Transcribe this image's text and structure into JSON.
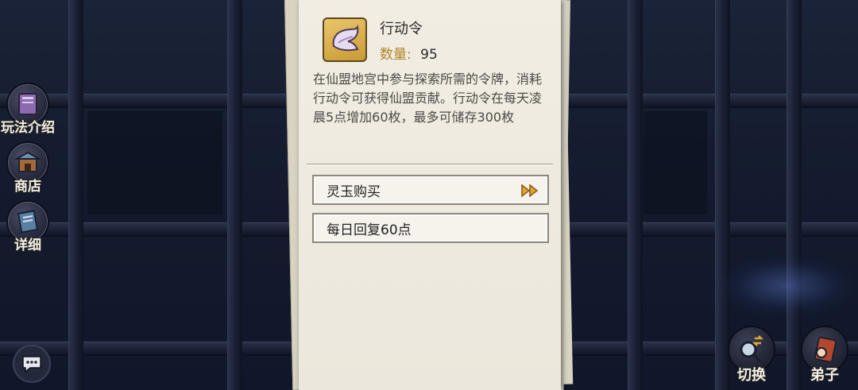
{
  "side_menu": {
    "items": [
      {
        "label": "玩法介绍",
        "icon": "book-icon"
      },
      {
        "label": "商店",
        "icon": "shop-icon"
      },
      {
        "label": "详细",
        "icon": "scroll-icon"
      }
    ],
    "chat_icon": "chat-bubble-icon"
  },
  "right_buttons": {
    "switch_label": "切换",
    "disciple_label": "弟子"
  },
  "item": {
    "name": "行动令",
    "quantity_label": "数量:",
    "quantity_value": "95",
    "icon": "token-icon",
    "description": "在仙盟地宫中参与探索所需的令牌，消耗行动令可获得仙盟贡献。行动令在每天凌晨5点增加60枚，最多可储存300枚"
  },
  "actions": {
    "buy_label": "灵玉购买",
    "regen_label": "每日回复60点"
  },
  "colors": {
    "paper": "#f1ede3",
    "quantity_label": "#b0852a",
    "arrow": "#e0a634"
  }
}
